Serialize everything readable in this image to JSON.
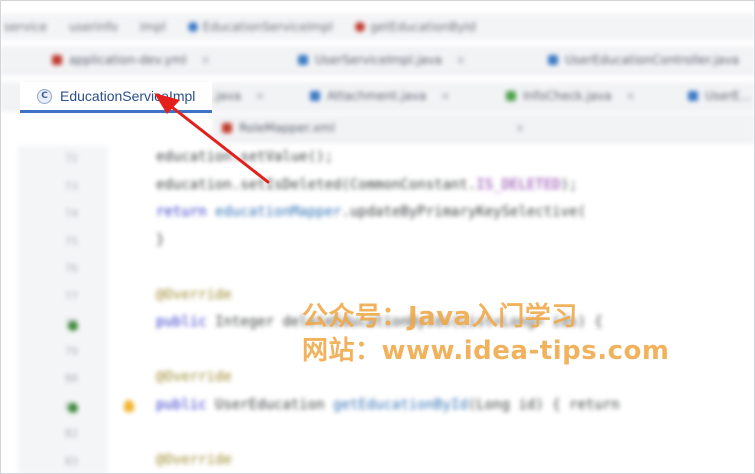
{
  "breadcrumb": {
    "items": [
      "service",
      "userinfo",
      "impl",
      "EducationServiceImpl",
      "getEducationById"
    ],
    "icons": [
      "",
      "",
      "",
      "class-icon",
      "method-icon"
    ]
  },
  "tabs_row1": [
    {
      "label": "application-dev.yml",
      "color": "#c0392b"
    },
    {
      "label": "UserServiceImpl.java",
      "color": "#3b79c4"
    },
    {
      "label": "UserEducationController.java",
      "color": "#3b79c4"
    }
  ],
  "tabs_row2": [
    {
      "label": "EducationServiceImpl.java",
      "active": true
    },
    {
      "label": "Attachment.java",
      "color": "#3b79c4"
    },
    {
      "label": "InfoCheck.java",
      "color": "#4aa04a"
    },
    {
      "label": "UserE...",
      "color": "#3b79c4"
    }
  ],
  "tabs_row3": [
    {
      "label": "RoleMapper.xml",
      "color": "#c0392b"
    }
  ],
  "active_tab": {
    "label": "EducationServiceImpl",
    "icon_letter": "C"
  },
  "editor": {
    "line_numbers": [
      "72",
      "73",
      "74",
      "75",
      "76",
      "77",
      "78",
      "79",
      "80",
      "81",
      "82",
      "83"
    ],
    "lines": [
      {
        "parts": [
          [
            "",
            "education.setValue();"
          ]
        ]
      },
      {
        "parts": [
          [
            "",
            "education.setIsDeleted(CommonConstant."
          ],
          [
            "str",
            "IS_DELETED"
          ],
          [
            "",
            ");"
          ]
        ]
      },
      {
        "parts": [
          [
            "kw",
            "return "
          ],
          [
            "fn",
            "educationMapper"
          ],
          [
            "",
            ".updateByPrimaryKeySelective("
          ]
        ]
      },
      {
        "parts": [
          [
            "",
            "}"
          ]
        ]
      },
      {
        "parts": [
          [
            "",
            ""
          ]
        ]
      },
      {
        "parts": [
          [
            "ann",
            "@Override"
          ]
        ]
      },
      {
        "parts": [
          [
            "kw",
            "public "
          ],
          [
            "",
            "Integer deleteEducationByIds(List<Long> ids) {"
          ]
        ]
      },
      {
        "parts": [
          [
            "",
            ""
          ]
        ]
      },
      {
        "parts": [
          [
            "ann",
            "@Override"
          ]
        ]
      },
      {
        "parts": [
          [
            "kw",
            "public "
          ],
          [
            "",
            "UserEducation "
          ],
          [
            "fn",
            "getEducationById"
          ],
          [
            "",
            "(Long id) { return"
          ]
        ]
      },
      {
        "parts": [
          [
            "",
            ""
          ]
        ]
      },
      {
        "parts": [
          [
            "ann",
            "@Override"
          ]
        ]
      }
    ]
  },
  "watermark": {
    "line1": "公众号：Java入门学习",
    "line2": "网站：www.idea-tips.com"
  },
  "colors": {
    "accent": "#3f72c6",
    "arrow": "#e3201b",
    "watermark": "#f0a847"
  }
}
